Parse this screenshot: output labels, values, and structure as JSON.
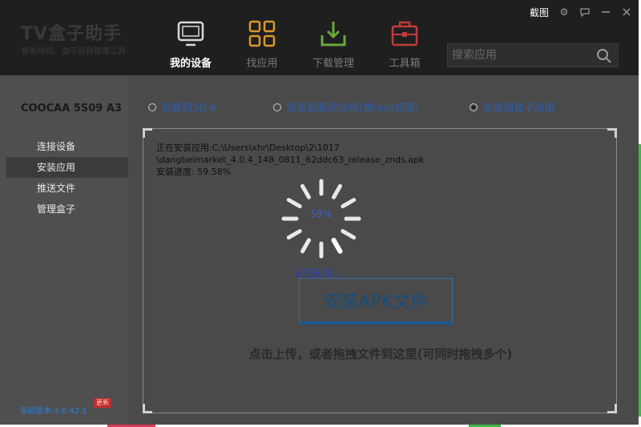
{
  "app": {
    "title": "TV盒子助手",
    "subtitle": "智能电视、盒子远程管理工具"
  },
  "titlebar": {
    "screenshot_label": "截图"
  },
  "nav": [
    {
      "label": "我的设备",
      "icon": "tv-icon",
      "active": true
    },
    {
      "label": "找应用",
      "icon": "grid-icon",
      "active": false
    },
    {
      "label": "下载管理",
      "icon": "download-icon",
      "active": false
    },
    {
      "label": "工具箱",
      "icon": "toolbox-icon",
      "active": false
    }
  ],
  "search": {
    "placeholder": "搜索应用"
  },
  "sidebar": {
    "device_name": "COOCAA 5S09 A3",
    "items": [
      {
        "label": "连接设备"
      },
      {
        "label": "安装应用"
      },
      {
        "label": "推送文件"
      },
      {
        "label": "管理盒子"
      }
    ],
    "version": "当前版本:3.0.42.1",
    "update_badge": "更新"
  },
  "install_targets": [
    {
      "label": "安装到SD卡",
      "selected": false
    },
    {
      "label": "安装到系统应用(需root权限)",
      "selected": false
    },
    {
      "label": "安装到盒子应用",
      "selected": true
    }
  ],
  "install": {
    "path_line1": "正在安装应用:C:\\Users\\xhr\\Desktop\\2\\1017",
    "path_line2": "\\dangbeimarket_4.0.4_148_0811_62ddc63_release_znds.apk",
    "progress_label": "安装进度:  59.58%",
    "progress_percent": "59%",
    "status": "正在安装..."
  },
  "dropzone": {
    "button_label": "安装APK文件",
    "hint": "点击上传，或者拖拽文件到这里(可同时拖拽多个)"
  },
  "colors": {
    "header_bg": "#1f1f1f",
    "panel_bg": "#4a4a4a",
    "link_blue": "#2a5fb5",
    "badge_red": "#c0302e"
  }
}
